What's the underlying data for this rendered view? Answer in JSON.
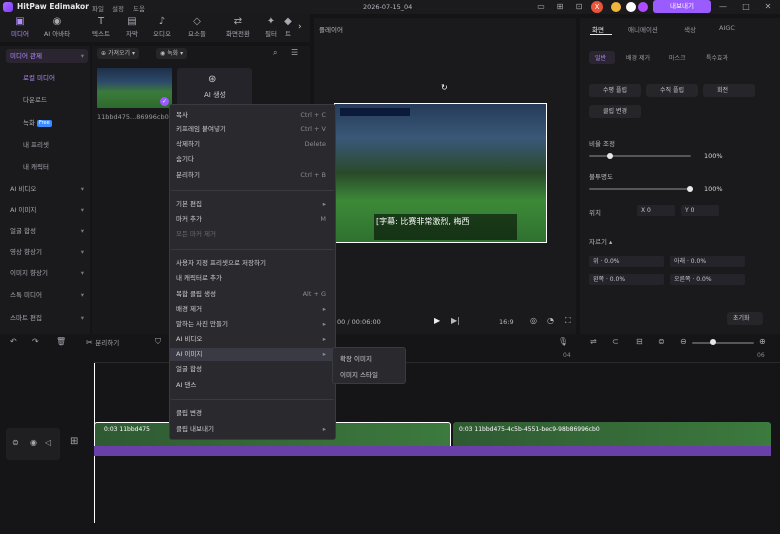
{
  "app": {
    "name": "HitPaw Edimakor",
    "menu": [
      "파일",
      "설정",
      "도움"
    ],
    "project": "2026-07-15_04",
    "export": "내보내기"
  },
  "toolbar": [
    {
      "icon": "media-icon",
      "label": "미디어"
    },
    {
      "icon": "ai-avatar-icon",
      "label": "AI 아바타"
    },
    {
      "icon": "text-icon",
      "label": "텍스트"
    },
    {
      "icon": "subtitle-icon",
      "label": "자막"
    },
    {
      "icon": "audio-icon",
      "label": "오디오"
    },
    {
      "icon": "elements-icon",
      "label": "요소들"
    },
    {
      "icon": "transition-icon",
      "label": "화면전환"
    },
    {
      "icon": "filter-icon",
      "label": "필터"
    },
    {
      "icon": "more-icon",
      "label": "트"
    }
  ],
  "leftnav": [
    {
      "label": "미디어 관제",
      "sel": true
    },
    {
      "label": "로컬 미디어",
      "sub": true,
      "sel": true
    },
    {
      "label": "다운로드",
      "sub": true
    },
    {
      "label": "녹화",
      "sub": true,
      "badge": "Free"
    },
    {
      "label": "내 프리셋",
      "sub": true
    },
    {
      "label": "내 캐릭터",
      "sub": true
    },
    {
      "label": "AI 비디오",
      "caret": true
    },
    {
      "label": "AI 이미지",
      "caret": true
    },
    {
      "label": "얼굴 합성",
      "caret": true
    },
    {
      "label": "영상 향상기",
      "caret": true
    },
    {
      "label": "이미지 향상기",
      "caret": true
    },
    {
      "label": "스톡 미디어",
      "caret": true
    },
    {
      "label": "스마트 편집",
      "caret": true
    }
  ],
  "media": {
    "import": "가져오기",
    "record": "녹화",
    "clip_name": "11bbd475...86996cb0",
    "ai_gen": "AI 생성"
  },
  "player": {
    "title": "플레이어",
    "time": "00 / 00:06:00",
    "ratio": "16:9",
    "subtitle": "[字幕: 比赛非常激烈, 梅西"
  },
  "props": {
    "tabs": [
      "화면",
      "애니메이션",
      "색상",
      "AIGC"
    ],
    "subtabs": [
      "일반",
      "배경 제거",
      "마스크",
      "특수효과"
    ],
    "buttons": [
      "수평 플립",
      "수직 플립",
      "회전",
      "클립 변경"
    ],
    "scale_label": "비율 조정",
    "scale_val": "100%",
    "opacity_label": "불투명도",
    "opacity_val": "100%",
    "pos_label": "위치",
    "x_label": "X",
    "x_val": "0",
    "y_label": "Y",
    "y_val": "0",
    "crop_label": "자르기",
    "top_label": "위",
    "top_val": "0.0%",
    "bottom_label": "아래",
    "bottom_val": "0.0%",
    "left_label": "왼쪽",
    "left_val": "0.0%",
    "right_label": "오른쪽",
    "right_val": "0.0%",
    "reset": "초기화"
  },
  "timeline": {
    "split": "분리하기",
    "ruler": [
      "04",
      "06"
    ],
    "clip1": "0:03  11bbd475",
    "clip2": "0:03  11bbd475-4c5b-4551-bec9-98b86996cb0"
  },
  "menu": {
    "items": [
      {
        "label": "복사",
        "sc": "Ctrl + C"
      },
      {
        "label": "키프레임 붙여넣기",
        "sc": "Ctrl + V"
      },
      {
        "label": "삭제하기",
        "sc": "Delete"
      },
      {
        "label": "숨기다",
        "sc": ""
      },
      {
        "label": "분리하기",
        "sc": "Ctrl + B"
      },
      {
        "label": "기본 편집",
        "arrow": true
      },
      {
        "label": "마커 추가",
        "sc": "M"
      },
      {
        "label": "모든 마커 제거",
        "dis": true
      },
      {
        "label": "사용자 지정 프리셋으로 저장하기"
      },
      {
        "label": "내 캐릭터로 추가"
      },
      {
        "label": "복합 클립 생성",
        "sc": "Alt + G"
      },
      {
        "label": "배경 제거",
        "arrow": true
      },
      {
        "label": "말하는 사진 만들기",
        "arrow": true
      },
      {
        "label": "AI 비디오",
        "arrow": true
      },
      {
        "label": "AI 이미지",
        "arrow": true
      },
      {
        "label": "얼굴 합성"
      },
      {
        "label": "AI 댄스"
      },
      {
        "label": "클립 변경"
      },
      {
        "label": "클립 내보내기",
        "arrow": true
      }
    ],
    "submenu": [
      "확장 이미지",
      "이미지 스타일"
    ]
  }
}
